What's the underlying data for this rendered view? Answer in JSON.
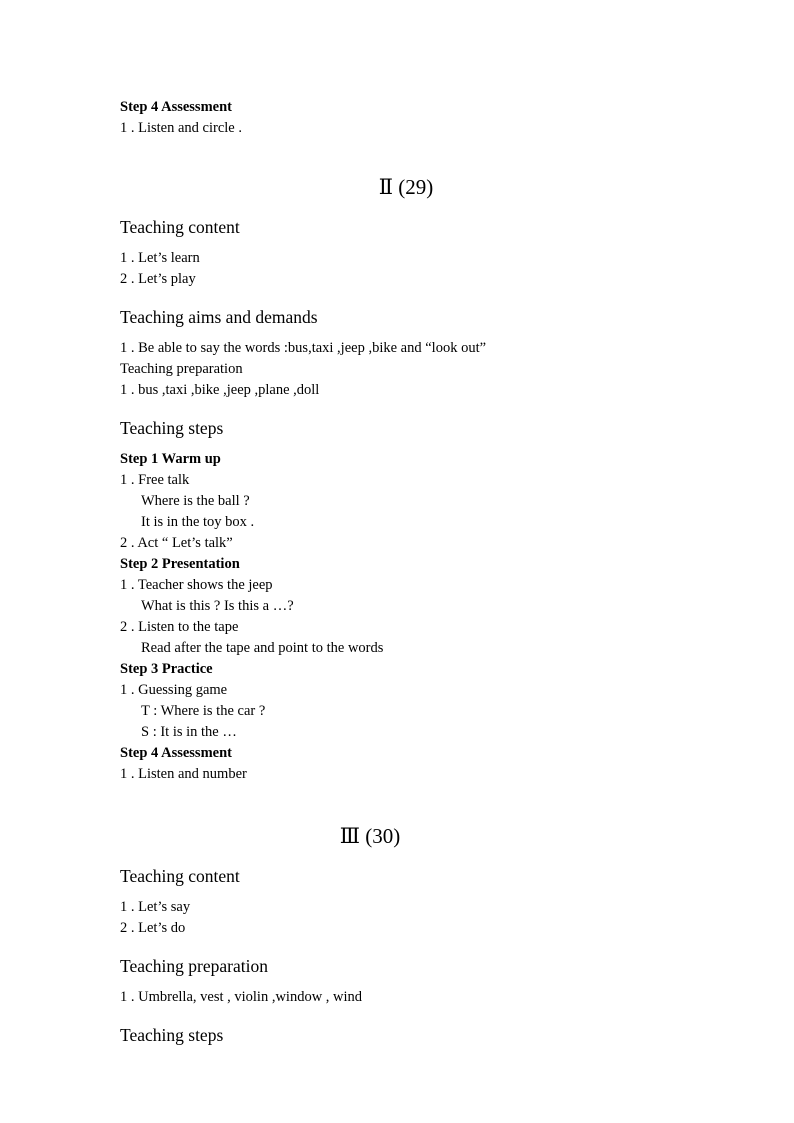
{
  "document": {
    "top_block": {
      "step4_heading": "Step 4 Assessment",
      "step4_item1": "1 . Listen and circle ."
    },
    "sections": [
      {
        "roman_title": "Ⅱ (29)",
        "blocks": [
          {
            "heading": "Teaching content"
          },
          {
            "lines": [
              "1 . Let’s learn",
              "2 . Let’s play"
            ]
          },
          {
            "heading": "Teaching aims and demands"
          },
          {
            "lines": [
              "1 . Be able to say the words :bus,taxi ,jeep ,bike and “look out”",
              "Teaching preparation",
              "1 . bus ,taxi ,bike ,jeep ,plane ,doll"
            ]
          },
          {
            "heading": "Teaching steps"
          },
          {
            "steps": [
              {
                "title": "Step 1 Warm up",
                "lines": [
                  {
                    "text": "1 . Free talk",
                    "indent": false
                  },
                  {
                    "text": "Where is the ball ?",
                    "indent": true
                  },
                  {
                    "text": "It is in the toy box .",
                    "indent": true
                  },
                  {
                    "text": "2 . Act “ Let’s talk”",
                    "indent": false
                  }
                ]
              },
              {
                "title": "Step 2 Presentation",
                "lines": [
                  {
                    "text": "1 . Teacher shows the jeep",
                    "indent": false
                  },
                  {
                    "text": "What is this ? Is this a …?",
                    "indent": true
                  },
                  {
                    "text": "2 . Listen to the tape",
                    "indent": false
                  },
                  {
                    "text": "Read after the tape and point to the words",
                    "indent": true
                  }
                ]
              },
              {
                "title": "Step 3 Practice",
                "lines": [
                  {
                    "text": "1 . Guessing game",
                    "indent": false
                  },
                  {
                    "text": "T : Where is the car ?",
                    "indent": true
                  },
                  {
                    "text": "S : It is in the …",
                    "indent": true
                  }
                ]
              },
              {
                "title": "Step 4 Assessment",
                "lines": [
                  {
                    "text": "1 . Listen and number",
                    "indent": false
                  }
                ]
              }
            ]
          }
        ]
      },
      {
        "roman_title": "Ⅲ (30)",
        "blocks": [
          {
            "heading": "Teaching content"
          },
          {
            "lines": [
              "1 . Let’s say",
              "2 . Let’s do"
            ]
          },
          {
            "heading": "Teaching preparation"
          },
          {
            "lines": [
              "1 . Umbrella, vest , violin ,window , wind"
            ]
          },
          {
            "heading": "Teaching steps"
          }
        ]
      }
    ]
  }
}
